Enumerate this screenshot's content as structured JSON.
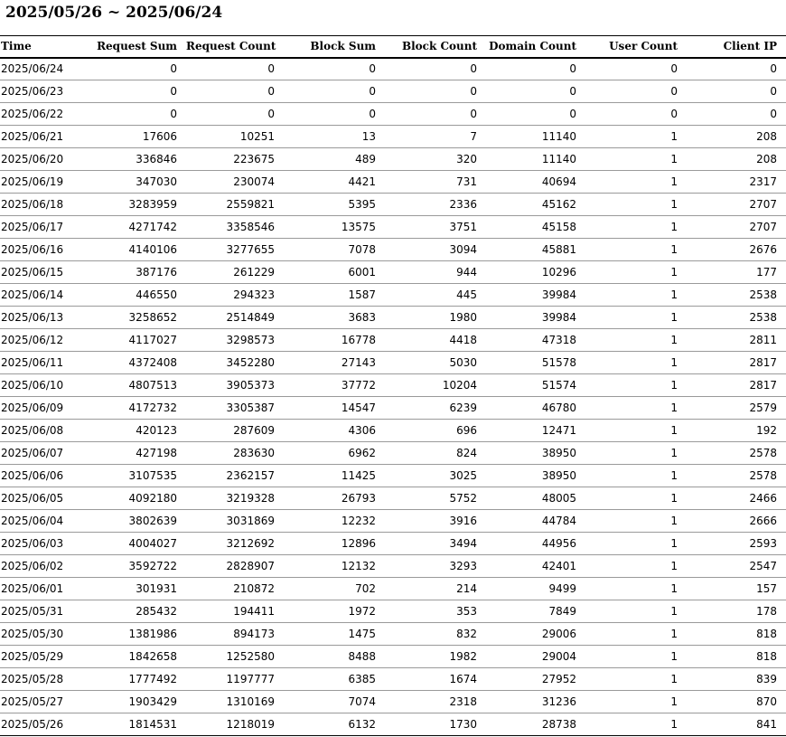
{
  "report": {
    "title": "2025/05/26 ~ 2025/06/24"
  },
  "table": {
    "headers": [
      "Time",
      "Request Sum",
      "Request Count",
      "Block Sum",
      "Block Count",
      "Domain Count",
      "User Count",
      "Client IP"
    ],
    "rows": [
      [
        "2025/06/24",
        "0",
        "0",
        "0",
        "0",
        "0",
        "0",
        "0"
      ],
      [
        "2025/06/23",
        "0",
        "0",
        "0",
        "0",
        "0",
        "0",
        "0"
      ],
      [
        "2025/06/22",
        "0",
        "0",
        "0",
        "0",
        "0",
        "0",
        "0"
      ],
      [
        "2025/06/21",
        "17606",
        "10251",
        "13",
        "7",
        "11140",
        "1",
        "208"
      ],
      [
        "2025/06/20",
        "336846",
        "223675",
        "489",
        "320",
        "11140",
        "1",
        "208"
      ],
      [
        "2025/06/19",
        "347030",
        "230074",
        "4421",
        "731",
        "40694",
        "1",
        "2317"
      ],
      [
        "2025/06/18",
        "3283959",
        "2559821",
        "5395",
        "2336",
        "45162",
        "1",
        "2707"
      ],
      [
        "2025/06/17",
        "4271742",
        "3358546",
        "13575",
        "3751",
        "45158",
        "1",
        "2707"
      ],
      [
        "2025/06/16",
        "4140106",
        "3277655",
        "7078",
        "3094",
        "45881",
        "1",
        "2676"
      ],
      [
        "2025/06/15",
        "387176",
        "261229",
        "6001",
        "944",
        "10296",
        "1",
        "177"
      ],
      [
        "2025/06/14",
        "446550",
        "294323",
        "1587",
        "445",
        "39984",
        "1",
        "2538"
      ],
      [
        "2025/06/13",
        "3258652",
        "2514849",
        "3683",
        "1980",
        "39984",
        "1",
        "2538"
      ],
      [
        "2025/06/12",
        "4117027",
        "3298573",
        "16778",
        "4418",
        "47318",
        "1",
        "2811"
      ],
      [
        "2025/06/11",
        "4372408",
        "3452280",
        "27143",
        "5030",
        "51578",
        "1",
        "2817"
      ],
      [
        "2025/06/10",
        "4807513",
        "3905373",
        "37772",
        "10204",
        "51574",
        "1",
        "2817"
      ],
      [
        "2025/06/09",
        "4172732",
        "3305387",
        "14547",
        "6239",
        "46780",
        "1",
        "2579"
      ],
      [
        "2025/06/08",
        "420123",
        "287609",
        "4306",
        "696",
        "12471",
        "1",
        "192"
      ],
      [
        "2025/06/07",
        "427198",
        "283630",
        "6962",
        "824",
        "38950",
        "1",
        "2578"
      ],
      [
        "2025/06/06",
        "3107535",
        "2362157",
        "11425",
        "3025",
        "38950",
        "1",
        "2578"
      ],
      [
        "2025/06/05",
        "4092180",
        "3219328",
        "26793",
        "5752",
        "48005",
        "1",
        "2466"
      ],
      [
        "2025/06/04",
        "3802639",
        "3031869",
        "12232",
        "3916",
        "44784",
        "1",
        "2666"
      ],
      [
        "2025/06/03",
        "4004027",
        "3212692",
        "12896",
        "3494",
        "44956",
        "1",
        "2593"
      ],
      [
        "2025/06/02",
        "3592722",
        "2828907",
        "12132",
        "3293",
        "42401",
        "1",
        "2547"
      ],
      [
        "2025/06/01",
        "301931",
        "210872",
        "702",
        "214",
        "9499",
        "1",
        "157"
      ],
      [
        "2025/05/31",
        "285432",
        "194411",
        "1972",
        "353",
        "7849",
        "1",
        "178"
      ],
      [
        "2025/05/30",
        "1381986",
        "894173",
        "1475",
        "832",
        "29006",
        "1",
        "818"
      ],
      [
        "2025/05/29",
        "1842658",
        "1252580",
        "8488",
        "1982",
        "29004",
        "1",
        "818"
      ],
      [
        "2025/05/28",
        "1777492",
        "1197777",
        "6385",
        "1674",
        "27952",
        "1",
        "839"
      ],
      [
        "2025/05/27",
        "1903429",
        "1310169",
        "7074",
        "2318",
        "31236",
        "1",
        "870"
      ],
      [
        "2025/05/26",
        "1814531",
        "1218019",
        "6132",
        "1730",
        "28738",
        "1",
        "841"
      ]
    ]
  }
}
